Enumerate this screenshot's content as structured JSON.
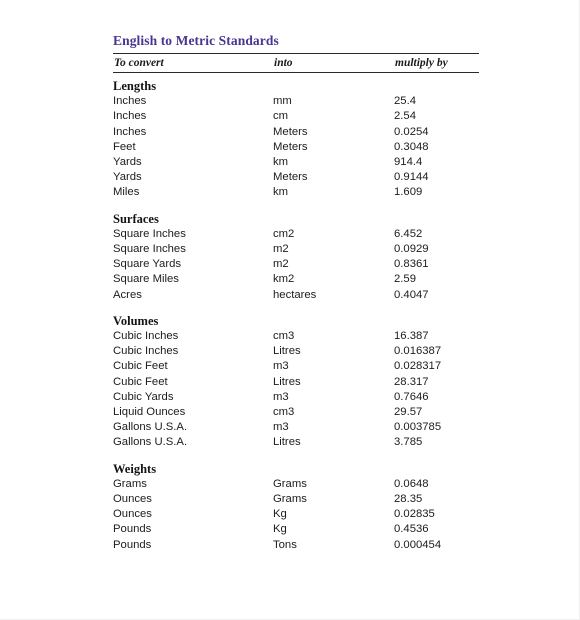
{
  "document": {
    "title": "English to Metric Standards",
    "title_color": "#4a3491",
    "columns": [
      "To convert",
      "into",
      "multiply by"
    ],
    "sections": [
      {
        "name": "Lengths",
        "rows": [
          {
            "from": "Inches",
            "to": "mm",
            "factor": "25.4"
          },
          {
            "from": "Inches",
            "to": "cm",
            "factor": "2.54"
          },
          {
            "from": "Inches",
            "to": "Meters",
            "factor": "0.0254"
          },
          {
            "from": "Feet",
            "to": "Meters",
            "factor": "0.3048"
          },
          {
            "from": "Yards",
            "to": "km",
            "factor": "914.4"
          },
          {
            "from": "Yards",
            "to": "Meters",
            "factor": "0.9144"
          },
          {
            "from": "Miles",
            "to": "km",
            "factor": "1.609"
          }
        ]
      },
      {
        "name": "Surfaces",
        "rows": [
          {
            "from": "Square Inches",
            "to": "cm2",
            "factor": "6.452"
          },
          {
            "from": "Square Inches",
            "to": "m2",
            "factor": "0.0929"
          },
          {
            "from": "Square Yards",
            "to": "m2",
            "factor": "0.8361"
          },
          {
            "from": "Square Miles",
            "to": "km2",
            "factor": "2.59"
          },
          {
            "from": "Acres",
            "to": "hectares",
            "factor": "0.4047"
          }
        ]
      },
      {
        "name": "Volumes",
        "rows": [
          {
            "from": "Cubic Inches",
            "to": "cm3",
            "factor": "16.387"
          },
          {
            "from": "Cubic Inches",
            "to": "Litres",
            "factor": "0.016387"
          },
          {
            "from": "Cubic Feet",
            "to": "m3",
            "factor": "0.028317"
          },
          {
            "from": "Cubic Feet",
            "to": "Litres",
            "factor": "28.317"
          },
          {
            "from": "Cubic Yards",
            "to": "m3",
            "factor": "0.7646"
          },
          {
            "from": "Liquid Ounces",
            "to": "cm3",
            "factor": "29.57"
          },
          {
            "from": "Gallons U.S.A.",
            "to": "m3",
            "factor": "0.003785"
          },
          {
            "from": "Gallons U.S.A.",
            "to": "Litres",
            "factor": "3.785"
          }
        ]
      },
      {
        "name": "Weights",
        "rows": [
          {
            "from": "Grams",
            "to": "Grams",
            "factor": "0.0648"
          },
          {
            "from": "Ounces",
            "to": "Grams",
            "factor": "28.35"
          },
          {
            "from": "Ounces",
            "to": "Kg",
            "factor": "0.02835"
          },
          {
            "from": "Pounds",
            "to": "Kg",
            "factor": "0.4536"
          },
          {
            "from": "Pounds",
            "to": "Tons",
            "factor": "0.000454"
          }
        ]
      }
    ]
  }
}
